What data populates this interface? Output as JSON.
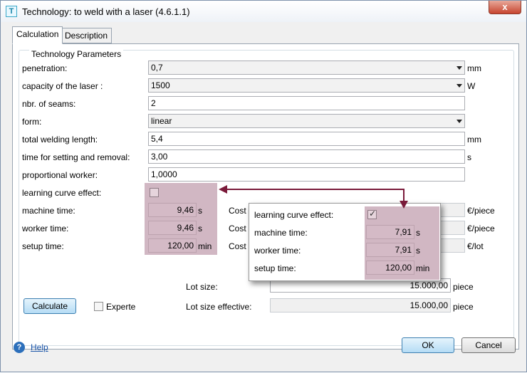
{
  "window": {
    "icon_letter": "T",
    "title": "Technology: to weld with a laser (4.6.1.1)",
    "close_glyph": "x"
  },
  "tabs": [
    {
      "label": "Calculation",
      "active": true
    },
    {
      "label": "Description",
      "active": false
    }
  ],
  "group_title": "Technology Parameters",
  "params": {
    "penetration": {
      "label": "penetration:",
      "value": "0,7",
      "unit": "mm"
    },
    "laser_capacity": {
      "label": "capacity of the laser :",
      "value": "1500",
      "unit": "W"
    },
    "seams": {
      "label": "nbr. of seams:",
      "value": "2"
    },
    "form": {
      "label": "form:",
      "value": "linear"
    },
    "welding_length": {
      "label": "total welding length:",
      "value": "5,4",
      "unit": "mm"
    },
    "setting_time": {
      "label": "time for setting and removal:",
      "value": "3,00",
      "unit": "s"
    },
    "worker": {
      "label": "proportional worker:",
      "value": "1,0000"
    },
    "learning_curve": {
      "label": "learning curve effect:",
      "checked": false
    },
    "machine_time": {
      "label": "machine time:",
      "value": "9,46",
      "unit": "s"
    },
    "worker_time": {
      "label": "worker time:",
      "value": "9,46",
      "unit": "s"
    },
    "setup_time": {
      "label": "setup time:",
      "value": "120,00",
      "unit": "min"
    }
  },
  "costs": {
    "label_prefix": "Cost r",
    "rows": [
      {
        "unit": "€/piece"
      },
      {
        "unit": "€/piece"
      },
      {
        "unit": "€/lot"
      }
    ]
  },
  "popup": {
    "learning_curve": {
      "label": "learning curve effect:",
      "checked": true
    },
    "machine_time": {
      "label": "machine time:",
      "value": "7,91",
      "unit": "s"
    },
    "worker_time": {
      "label": "worker time:",
      "value": "7,91",
      "unit": "s"
    },
    "setup_time": {
      "label": "setup time:",
      "value": "120,00",
      "unit": "min"
    }
  },
  "lot": {
    "lot_size": {
      "label": "Lot size:",
      "value": "15.000,00",
      "unit": "piece"
    },
    "lot_size_effective": {
      "label": "Lot size effective:",
      "value": "15.000,00",
      "unit": "piece"
    }
  },
  "actions": {
    "calculate": "Calculate",
    "experte": "Experte",
    "experte_checked": false,
    "help": "Help",
    "ok": "OK",
    "cancel": "Cancel"
  },
  "colors": {
    "highlight": "#d4bac6",
    "connector": "#7a1a3a",
    "accent_link": "#1a54a8"
  }
}
